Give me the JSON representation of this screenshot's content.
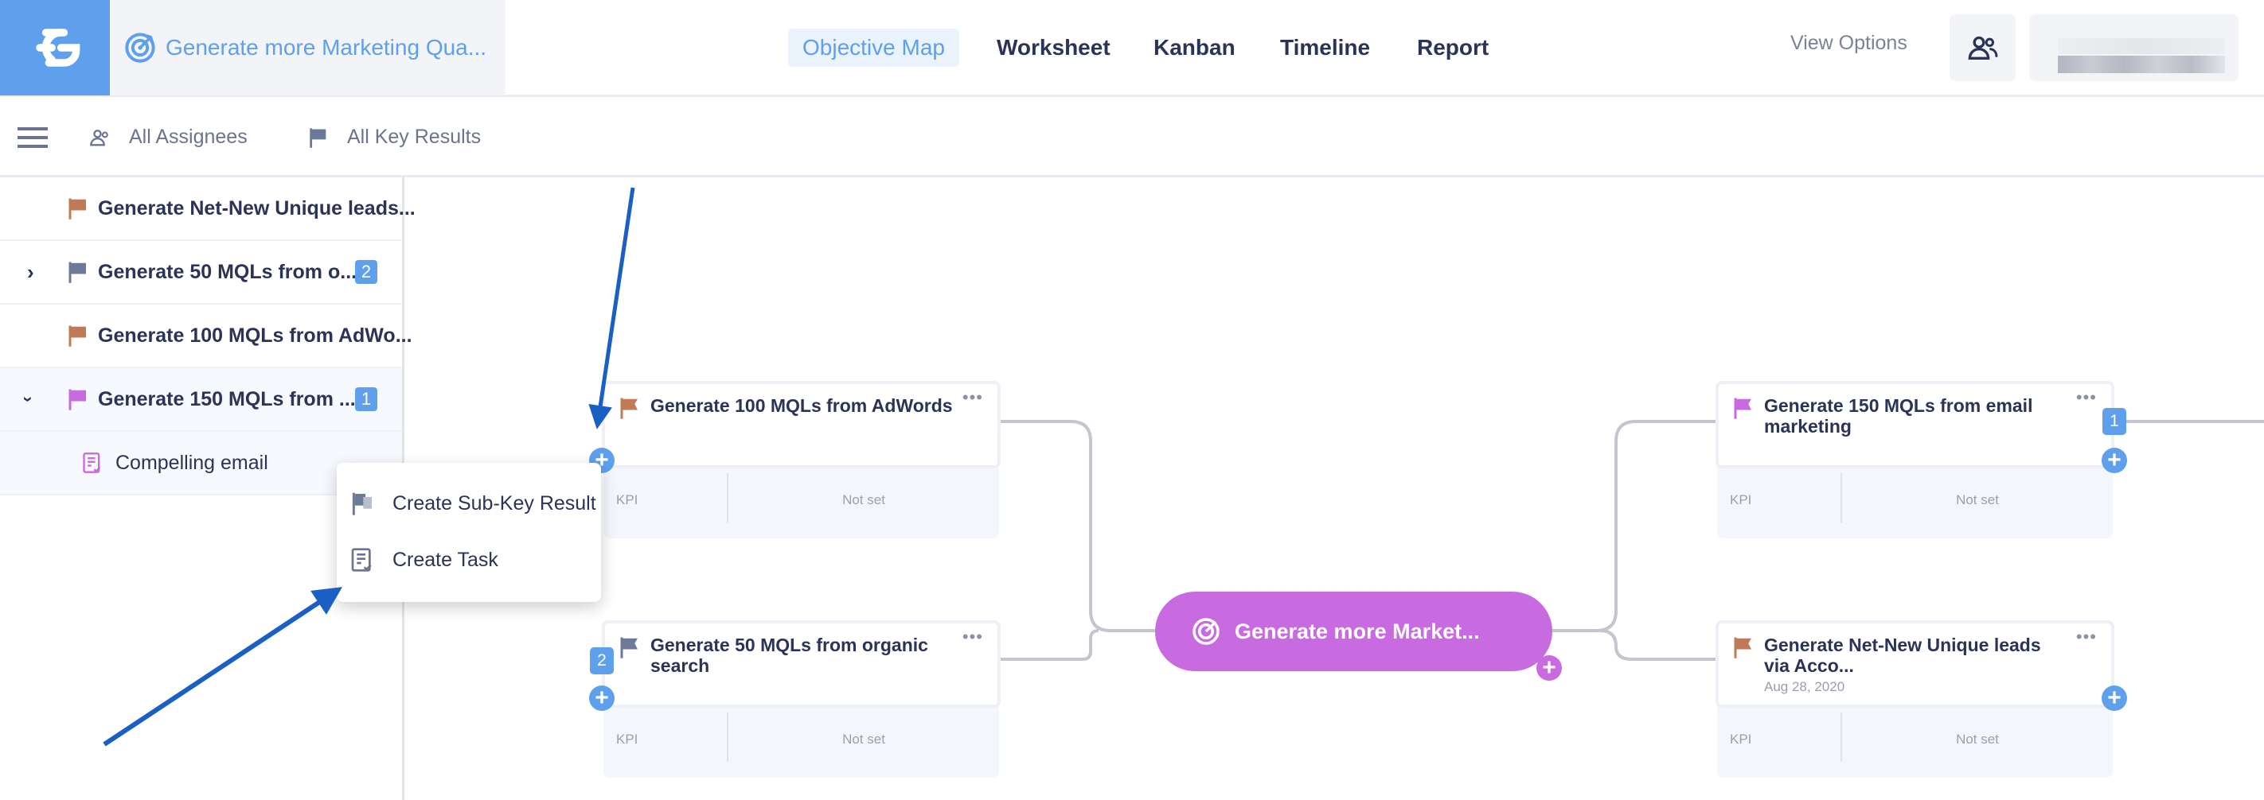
{
  "header": {
    "objective_title": "Generate more Marketing Qua...",
    "tabs": [
      {
        "label": "Objective Map",
        "active": true
      },
      {
        "label": "Worksheet",
        "active": false
      },
      {
        "label": "Kanban",
        "active": false
      },
      {
        "label": "Timeline",
        "active": false
      },
      {
        "label": "Report",
        "active": false
      }
    ],
    "view_options": "View Options"
  },
  "toolbar": {
    "assignees": "All Assignees",
    "key_results": "All Key Results"
  },
  "sidebar": {
    "items": [
      {
        "label": "Generate Net-New Unique leads...",
        "flag_color": "#c07a55"
      },
      {
        "label": "Generate 50 MQLs from o...",
        "flag_color": "#6b7a99",
        "count": "2",
        "expand": "collapsed"
      },
      {
        "label": "Generate 100 MQLs from AdWo...",
        "flag_color": "#c07a55"
      },
      {
        "label": "Generate 150 MQLs from ...",
        "flag_color": "#c86ae0",
        "count": "1",
        "expand": "expanded"
      }
    ],
    "child": {
      "label": "Compelling email"
    }
  },
  "context_menu": {
    "items": [
      {
        "label": "Create Sub-Key Result",
        "icon": "flag-icon"
      },
      {
        "label": "Create Task",
        "icon": "task-icon"
      }
    ]
  },
  "map": {
    "objective": {
      "label": "Generate more Market...",
      "color": "#c86ae0"
    },
    "cards": [
      {
        "title": "Generate 100 MQLs from AdWords",
        "flag_color": "#c07a55",
        "kpi": "KPI",
        "kpi_value": "Not set"
      },
      {
        "title": "Generate 50 MQLs from organic    search",
        "flag_color": "#6b7a99",
        "kpi": "KPI",
        "kpi_value": "Not set",
        "count": "2"
      },
      {
        "title": "Generate 150 MQLs from email    marketing",
        "flag_color": "#c86ae0",
        "kpi": "KPI",
        "kpi_value": "Not set",
        "count": "1"
      },
      {
        "title": "Generate Net-New Unique leads    via Acco...",
        "date": "Aug 28, 2020",
        "flag_color": "#c07a55",
        "kpi": "KPI",
        "kpi_value": "Not set"
      }
    ]
  },
  "colors": {
    "accent": "#5ea0ec",
    "objective": "#c86ae0",
    "annotation_arrow": "#1a5fc4"
  }
}
